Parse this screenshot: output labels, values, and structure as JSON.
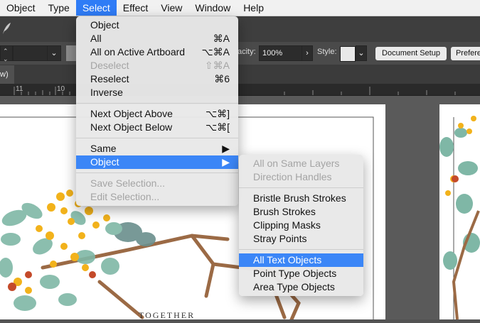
{
  "menubar": {
    "items": [
      "Object",
      "Type",
      "Select",
      "Effect",
      "View",
      "Window",
      "Help"
    ],
    "active": "Select"
  },
  "tab": {
    "label": "w)"
  },
  "ruler": {
    "ticks": [
      "11",
      "10"
    ]
  },
  "control": {
    "opacity_label": "acity:",
    "opacity_value": "100%",
    "style_label": "Style:",
    "doc_setup": "Document Setup",
    "prefs": "Prefere"
  },
  "select_menu": {
    "items": [
      {
        "label": "Object",
        "shortcut": "",
        "disabled": false,
        "submenu": false
      },
      {
        "label": "All",
        "shortcut": "⌘A",
        "disabled": false,
        "submenu": false
      },
      {
        "label": "All on Active Artboard",
        "shortcut": "⌥⌘A",
        "disabled": false,
        "submenu": false
      },
      {
        "label": "Deselect",
        "shortcut": "⇧⌘A",
        "disabled": true,
        "submenu": false
      },
      {
        "label": "Reselect",
        "shortcut": "⌘6",
        "disabled": false,
        "submenu": false
      },
      {
        "label": "Inverse",
        "shortcut": "",
        "disabled": false,
        "submenu": false
      },
      {
        "label": "Next Object Above",
        "shortcut": "⌥⌘]",
        "disabled": false,
        "submenu": false
      },
      {
        "label": "Next Object Below",
        "shortcut": "⌥⌘[",
        "disabled": false,
        "submenu": false
      },
      {
        "label": "Same",
        "shortcut": "",
        "disabled": false,
        "submenu": true
      },
      {
        "label": "Object",
        "shortcut": "",
        "disabled": false,
        "submenu": true,
        "highlighted": true
      },
      {
        "label": "Save Selection...",
        "shortcut": "",
        "disabled": true,
        "submenu": false
      },
      {
        "label": "Edit Selection...",
        "shortcut": "",
        "disabled": true,
        "submenu": false
      }
    ]
  },
  "object_submenu": {
    "items": [
      {
        "label": "All on Same Layers",
        "disabled": true
      },
      {
        "label": "Direction Handles",
        "disabled": true
      },
      {
        "label": "Bristle Brush Strokes",
        "disabled": false
      },
      {
        "label": "Brush Strokes",
        "disabled": false
      },
      {
        "label": "Clipping Masks",
        "disabled": false
      },
      {
        "label": "Stray Points",
        "disabled": false
      },
      {
        "label": "All Text Objects",
        "disabled": false,
        "highlighted": true
      },
      {
        "label": "Point Type Objects",
        "disabled": false
      },
      {
        "label": "Area Type Objects",
        "disabled": false
      }
    ]
  },
  "artboard": {
    "text": "TOGETHER"
  },
  "colors": {
    "accent": "#3b86f7",
    "branch": "#9b6a45",
    "leaf": "#7fb7a6",
    "berry": "#f2b21b"
  }
}
